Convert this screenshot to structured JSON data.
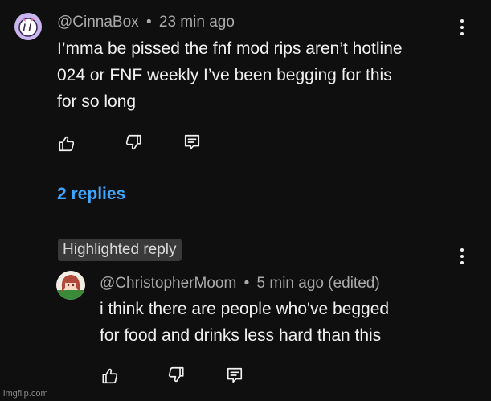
{
  "comment": {
    "handle": "@CinnaBox",
    "separator": "•",
    "time": "23 min ago",
    "text_lines": [
      "I’mma be pissed the fnf mod rips aren’t hotline",
      "024 or FNF weekly I’ve been begging for this",
      "for so long"
    ],
    "replies_label": "2 replies"
  },
  "highlighted_reply": {
    "badge": "Highlighted reply",
    "handle": "@ChristopherMoom",
    "separator": "•",
    "time": "5 min ago (edited)",
    "text_lines": [
      "i think there are people who've begged",
      "for food and drinks less hard than this"
    ]
  },
  "watermark": "imgflip.com",
  "icons": [
    "like-icon",
    "dislike-icon",
    "reply-icon",
    "more-options-icon"
  ],
  "colors": {
    "background": "#0f0f0f",
    "text": "#f1f1f1",
    "meta": "#aaaaaa",
    "link": "#3ea6ff",
    "badge_bg": "#3a3a3a"
  }
}
